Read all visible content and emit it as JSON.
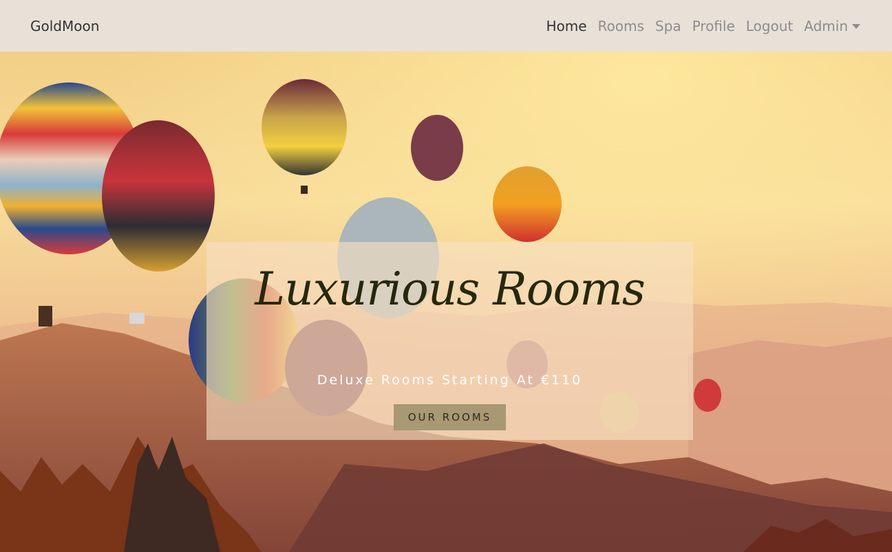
{
  "navbar": {
    "brand": "GoldMoon",
    "links": [
      {
        "label": "Home",
        "active": true
      },
      {
        "label": "Rooms",
        "active": false
      },
      {
        "label": "Spa",
        "active": false
      },
      {
        "label": "Profile",
        "active": false
      },
      {
        "label": "Logout",
        "active": false
      }
    ],
    "dropdown": {
      "label": "Admin",
      "icon": "caret-down-icon"
    }
  },
  "hero": {
    "title": "Luxurious Rooms",
    "subtitle": "Deluxe Rooms Starting At €110",
    "button_label": "OUR ROOMS",
    "image": "hot-air-balloons-over-mountains"
  },
  "colors": {
    "navbar_bg": "#e7e1d8",
    "nav_active": "#333333",
    "nav_inactive": "#8c8c8c",
    "caption_bg": "#f7e0c4",
    "button_bg": "#a89874",
    "title": "#26280d"
  }
}
